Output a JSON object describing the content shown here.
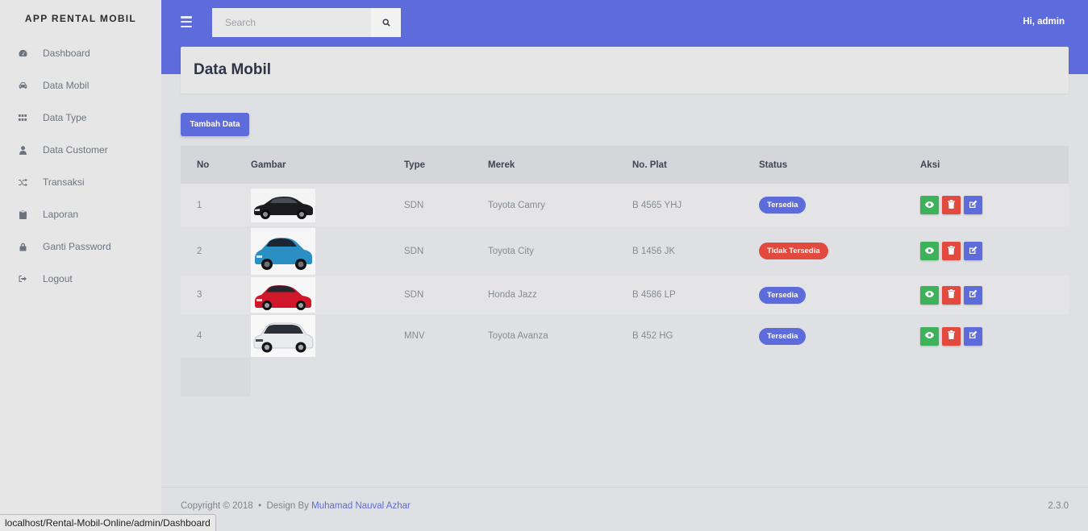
{
  "app": {
    "brand": "APP RENTAL MOBIL"
  },
  "sidebar": {
    "items": [
      {
        "label": "Dashboard",
        "icon": "dashboard-icon"
      },
      {
        "label": "Data Mobil",
        "icon": "car-icon"
      },
      {
        "label": "Data Type",
        "icon": "grid-icon"
      },
      {
        "label": "Data Customer",
        "icon": "user-icon"
      },
      {
        "label": "Transaksi",
        "icon": "shuffle-icon"
      },
      {
        "label": "Laporan",
        "icon": "clipboard-icon"
      },
      {
        "label": "Ganti Password",
        "icon": "lock-icon"
      },
      {
        "label": "Logout",
        "icon": "logout-icon"
      }
    ]
  },
  "header": {
    "search_placeholder": "Search",
    "greeting": "Hi, admin"
  },
  "page": {
    "title": "Data Mobil",
    "add_button": "Tambah Data"
  },
  "table": {
    "columns": [
      "No",
      "Gambar",
      "Type",
      "Merek",
      "No. Plat",
      "Status",
      "Aksi"
    ],
    "rows": [
      {
        "no": "1",
        "image": "black-sedan",
        "type": "SDN",
        "merek": "Toyota Camry",
        "plat": "B 4565 YHJ",
        "status": "Tersedia",
        "status_kind": "ok"
      },
      {
        "no": "2",
        "image": "blue-hatchback",
        "type": "SDN",
        "merek": "Toyota City",
        "plat": "B 1456 JK",
        "status": "Tidak Tersedia",
        "status_kind": "no"
      },
      {
        "no": "3",
        "image": "red-hatchback",
        "type": "SDN",
        "merek": "Honda Jazz",
        "plat": "B 4586 LP",
        "status": "Tersedia",
        "status_kind": "ok"
      },
      {
        "no": "4",
        "image": "white-mpv",
        "type": "MNV",
        "merek": "Toyota Avanza",
        "plat": "B 452 HG",
        "status": "Tersedia",
        "status_kind": "ok"
      }
    ]
  },
  "footer": {
    "copyright": "Copyright © 2018",
    "separator": "•",
    "design_by": "Design By",
    "author": "Muhamad Nauval Azhar",
    "version": "2.3.0"
  },
  "statusbar": {
    "url": "localhost/Rental-Mobil-Online/admin/Dashboard"
  },
  "colors": {
    "primary": "#5d6bdb",
    "success": "#3db25a",
    "danger": "#e2493f",
    "sidebar_bg": "#e6e6e6",
    "page_bg": "#dfe0e3"
  }
}
